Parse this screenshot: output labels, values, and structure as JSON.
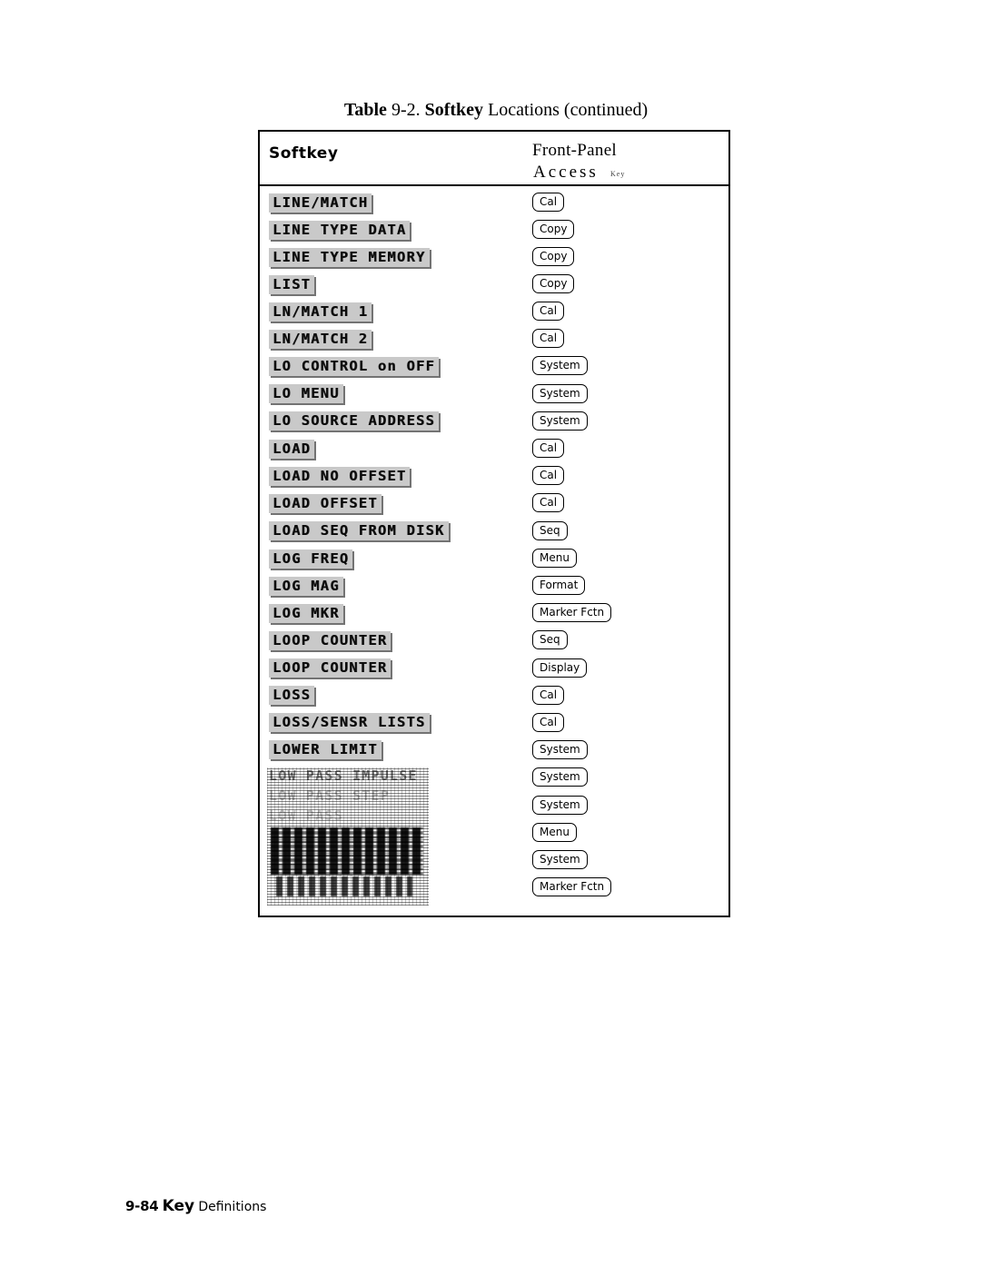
{
  "document": {
    "caption": {
      "table_word": "Table",
      "number": "9-2.",
      "softkey_word": "Softkey",
      "rest": "Locations (continued)"
    },
    "footer": {
      "page": "9-84",
      "key_word": "Key",
      "definitions": "Definitions"
    }
  },
  "table": {
    "headers": {
      "col1": "Softkey",
      "col2_line1": "Front-Panel",
      "col2_line2": "Access",
      "col2_sub": "Key"
    },
    "rows": [
      {
        "softkey": "LINE/MATCH",
        "key": "Cal"
      },
      {
        "softkey": "LINE TYPE DATA",
        "key": "Copy"
      },
      {
        "softkey": "LINE TYPE MEMORY",
        "key": "Copy"
      },
      {
        "softkey": "LIST",
        "key": "Copy"
      },
      {
        "softkey": "LN/MATCH 1",
        "key": "Cal"
      },
      {
        "softkey": "LN/MATCH 2",
        "key": "Cal"
      },
      {
        "softkey": "LO CONTROL on OFF",
        "key": "System"
      },
      {
        "softkey": "LO MENU",
        "key": "System"
      },
      {
        "softkey": "LO SOURCE ADDRESS",
        "key": "System"
      },
      {
        "softkey": "LOAD",
        "key": "Cal"
      },
      {
        "softkey": "LOAD NO OFFSET",
        "key": "Cal"
      },
      {
        "softkey": "LOAD OFFSET",
        "key": "Cal"
      },
      {
        "softkey": "LOAD SEQ FROM DISK",
        "key": "Seq"
      },
      {
        "softkey": "LOG FREQ",
        "key": "Menu"
      },
      {
        "softkey": "LOG MAG",
        "key": "Format"
      },
      {
        "softkey": "LOG MKR",
        "key": "Marker Fctn"
      },
      {
        "softkey": "LOOP COUNTER",
        "key": "Seq"
      },
      {
        "softkey": "LOOP COUNTER",
        "key": "Display"
      },
      {
        "softkey": "LOSS",
        "key": "Cal"
      },
      {
        "softkey": "LOSS/SENSR LISTS",
        "key": "Cal"
      },
      {
        "softkey": "LOWER LIMIT",
        "key": "System"
      },
      {
        "softkey": "LOW PASS IMPULSE",
        "key": "System"
      },
      {
        "softkey": "LOW PASS STEP",
        "key": "System"
      },
      {
        "softkey": "LOW PASS",
        "key": "Menu"
      },
      {
        "softkey": "LPF on OFF",
        "key": "System"
      },
      {
        "softkey": "LSB on OFF",
        "key": "Marker Fctn"
      }
    ]
  }
}
